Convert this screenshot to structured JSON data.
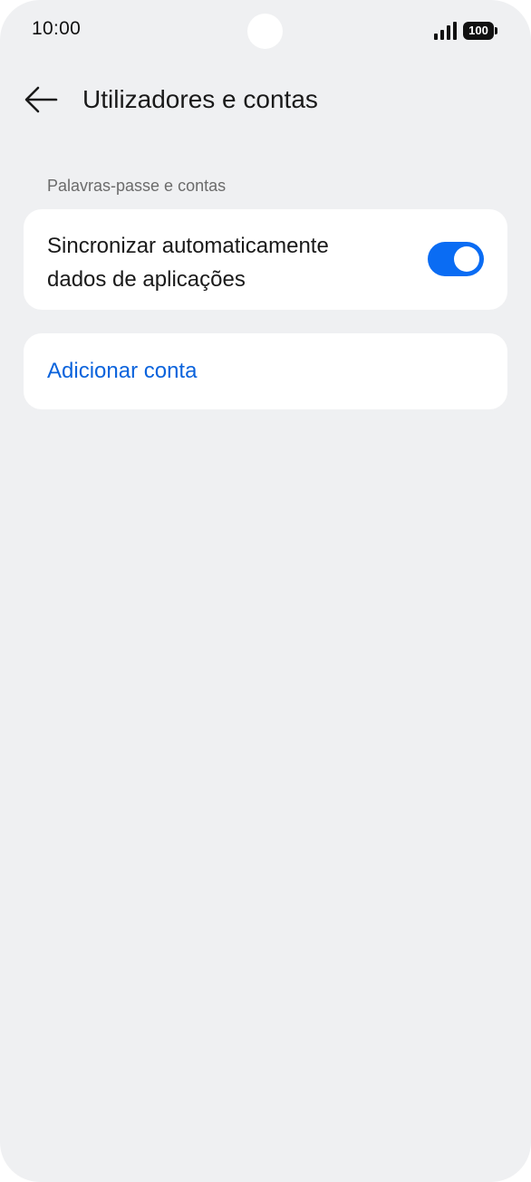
{
  "status_bar": {
    "time": "10:00",
    "battery": "100",
    "icons": [
      "signal-icon",
      "battery-icon"
    ]
  },
  "header": {
    "title": "Utilizadores e contas",
    "back_icon": "back-arrow-icon"
  },
  "section": {
    "label": "Palavras-passe e contas"
  },
  "sync_setting": {
    "label_line1": "Sincronizar automaticamente",
    "label_line2": "dados de aplicações",
    "enabled": true
  },
  "add_account": {
    "label": "Adicionar conta"
  },
  "colors": {
    "accent": "#0a6cf3",
    "link": "#0b63dc",
    "background": "#eff0f2",
    "card": "#ffffff"
  }
}
